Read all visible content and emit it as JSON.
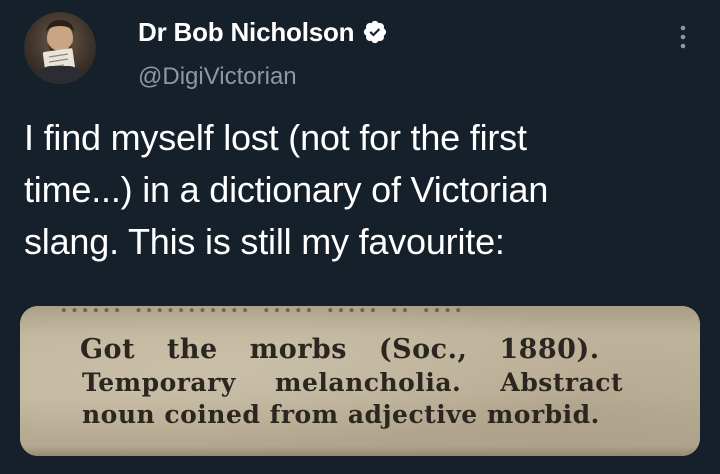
{
  "tweet": {
    "author": {
      "display_name": "Dr Bob Nicholson",
      "handle": "@DigiVictorian",
      "verified": true,
      "verified_icon": "verified-badge-icon",
      "avatar_icon": "profile-photo"
    },
    "more_icon": "more-options-icon",
    "text_lines": [
      "I find myself lost (not for the first",
      "time...) in a dictionary of Victorian",
      "slang. This is still my favourite:"
    ],
    "media": {
      "scan_lines": [
        "Got the morbs (Soc., 1880).",
        "Temporary melancholia. Abstract",
        "noun coined from adjective morbid."
      ],
      "scan_top_fragment": "...... ........... ..... ..... .. ...."
    }
  },
  "colors": {
    "background": "#15202b",
    "text_primary": "#ffffff",
    "text_secondary": "#8b98a5",
    "verified_badge": "#ffffff",
    "page_scan": "#bfb39b"
  }
}
